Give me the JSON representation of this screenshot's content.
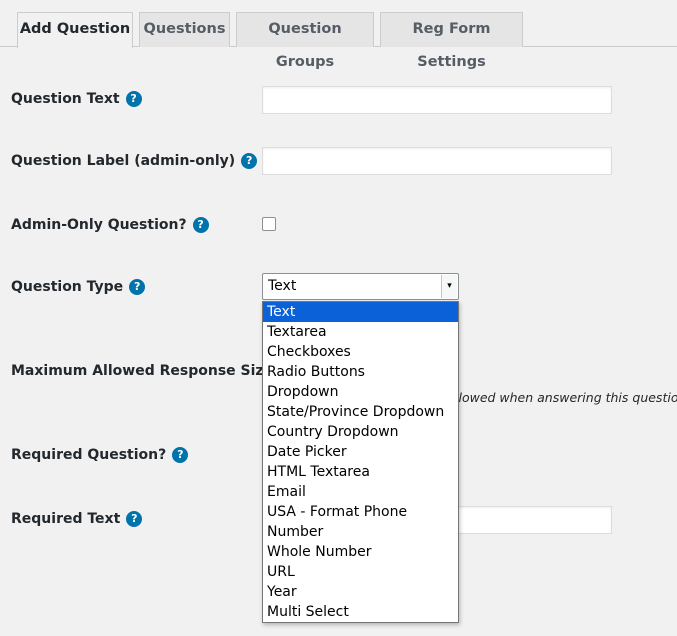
{
  "tabs": [
    {
      "label": "Add Question",
      "active": true
    },
    {
      "label": "Questions",
      "active": false
    },
    {
      "label": "Question Groups",
      "active": false
    },
    {
      "label": "Reg Form Settings",
      "active": false
    }
  ],
  "help_icon_glyph": "?",
  "fields": {
    "question_text": {
      "label": "Question Text",
      "value": ""
    },
    "question_label": {
      "label": "Question Label (admin-only)",
      "value": ""
    },
    "admin_only": {
      "label": "Admin-Only Question?",
      "checked": false
    },
    "question_type": {
      "label": "Question Type",
      "selected": "Text",
      "arrow_glyph": "▾",
      "options": [
        "Text",
        "Textarea",
        "Checkboxes",
        "Radio Buttons",
        "Dropdown",
        "State/Province Dropdown",
        "Country Dropdown",
        "Date Picker",
        "HTML Textarea",
        "Email",
        "USA - Format Phone",
        "Number",
        "Whole Number",
        "URL",
        "Year",
        "Multi Select"
      ]
    },
    "max_response": {
      "label": "Maximum Allowed Response Size",
      "description_fragment": "llowed when answering this question"
    },
    "required_question": {
      "label": "Required Question?"
    },
    "required_text": {
      "label": "Required Text",
      "value": ""
    }
  },
  "colors": {
    "accent": "#0073aa",
    "selected_option": "#0a61d8",
    "background": "#f1f1f1"
  }
}
